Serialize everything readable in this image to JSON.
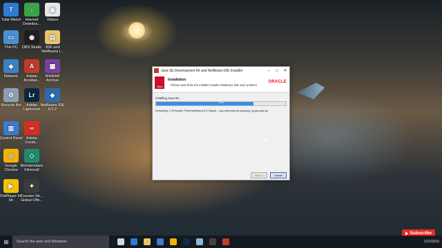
{
  "desktop": {
    "icons": [
      {
        "label": "Tubir Metch",
        "icon": "app-icon",
        "color": "#2d7bd6",
        "glyph": "T"
      },
      {
        "label": "Internet Downloa...",
        "icon": "internet-download-icon",
        "color": "#3aa34a",
        "glyph": "↓"
      },
      {
        "label": "Videos",
        "icon": "videos-folder-icon",
        "color": "#e8e8e8",
        "glyph": "▣"
      },
      {
        "label": "This PC",
        "icon": "this-pc-icon",
        "color": "#4a90d9",
        "glyph": "▭"
      },
      {
        "label": "OBS Studio",
        "icon": "obs-icon",
        "color": "#1e1e1e",
        "glyph": "◉"
      },
      {
        "label": "JDK and NetBeans I...",
        "icon": "folder-icon",
        "color": "#e9c46a",
        "glyph": "▤"
      },
      {
        "label": "Network",
        "icon": "network-icon",
        "color": "#3b82c4",
        "glyph": "◈"
      },
      {
        "label": "Adobe Acrobat...",
        "icon": "acrobat-icon",
        "color": "#c0392b",
        "glyph": "A"
      },
      {
        "label": "WinRAR Archive",
        "icon": "winrar-icon",
        "color": "#7b3fa0",
        "glyph": "▦"
      },
      {
        "label": "Recycle Bin",
        "icon": "recycle-bin-icon",
        "color": "#8aa1b5",
        "glyph": "♻"
      },
      {
        "label": "Adobe Lightroom",
        "icon": "lightroom-icon",
        "color": "#0b2740",
        "glyph": "Lr"
      },
      {
        "label": "NetBeans IDE 8.0.2",
        "icon": "netbeans-icon",
        "color": "#2b6cb0",
        "glyph": "◆"
      },
      {
        "label": "Control Panel",
        "icon": "control-panel-icon",
        "color": "#3a7bd5",
        "glyph": "▥"
      },
      {
        "label": "Adobe Creati...",
        "icon": "creative-cloud-icon",
        "color": "#d62d20",
        "glyph": "∞"
      },
      {
        "label": "Google Chrome",
        "icon": "chrome-icon",
        "color": "#f4b400",
        "glyph": "◎"
      },
      {
        "label": "Wondershare Filmora9",
        "icon": "filmora-icon",
        "color": "#1f8a70",
        "glyph": "◇"
      },
      {
        "label": "PotPlayer 64 bit",
        "icon": "potplayer-icon",
        "color": "#f2c200",
        "glyph": "▶"
      },
      {
        "label": "Counter-Str... Global Offe...",
        "icon": "csgo-icon",
        "color": "#3c3c3c",
        "glyph": "✦"
      }
    ]
  },
  "installer": {
    "window_title": "Java SE Development Kit and NetBeans IDE Installer",
    "heading": "Installation",
    "subheading": "Please wait while the installer installs NetBeans IDE and runtimes.",
    "brand": "ORACLE",
    "java_logo_text": "Java",
    "status_label": "Installing Java SE...",
    "progress_percent": 75,
    "progress_text": "75%",
    "extracting_text": "Extracting: C:\\Program Files\\NetBeans 8.0.2\\java\\...\\org-netbeans-lib-javacapi_ja.jar.pack.gz",
    "next_label": "Next >",
    "cancel_label": "Cancel",
    "minimize": "–",
    "maximize": "□",
    "close": "✕"
  },
  "taskbar": {
    "start_glyph": "⊞",
    "search_placeholder": "Search the web and Windows",
    "pinned": [
      {
        "icon": "task-view-icon",
        "color": "#cfd8e3"
      },
      {
        "icon": "edge-icon",
        "color": "#2b7bd6"
      },
      {
        "icon": "file-explorer-icon",
        "color": "#e9c46a"
      },
      {
        "icon": "store-icon",
        "color": "#3a7bd5"
      },
      {
        "icon": "chrome-icon",
        "color": "#f4b400"
      },
      {
        "icon": "photoshop-icon",
        "color": "#0b2c4d"
      },
      {
        "icon": "notepad-icon",
        "color": "#8fb6d9"
      },
      {
        "icon": "obs-icon",
        "color": "#444444"
      },
      {
        "icon": "installer-icon",
        "color": "#c0392b"
      }
    ],
    "date": "1/22/2016"
  },
  "overlay": {
    "subscribe_label": "Subscribe"
  }
}
